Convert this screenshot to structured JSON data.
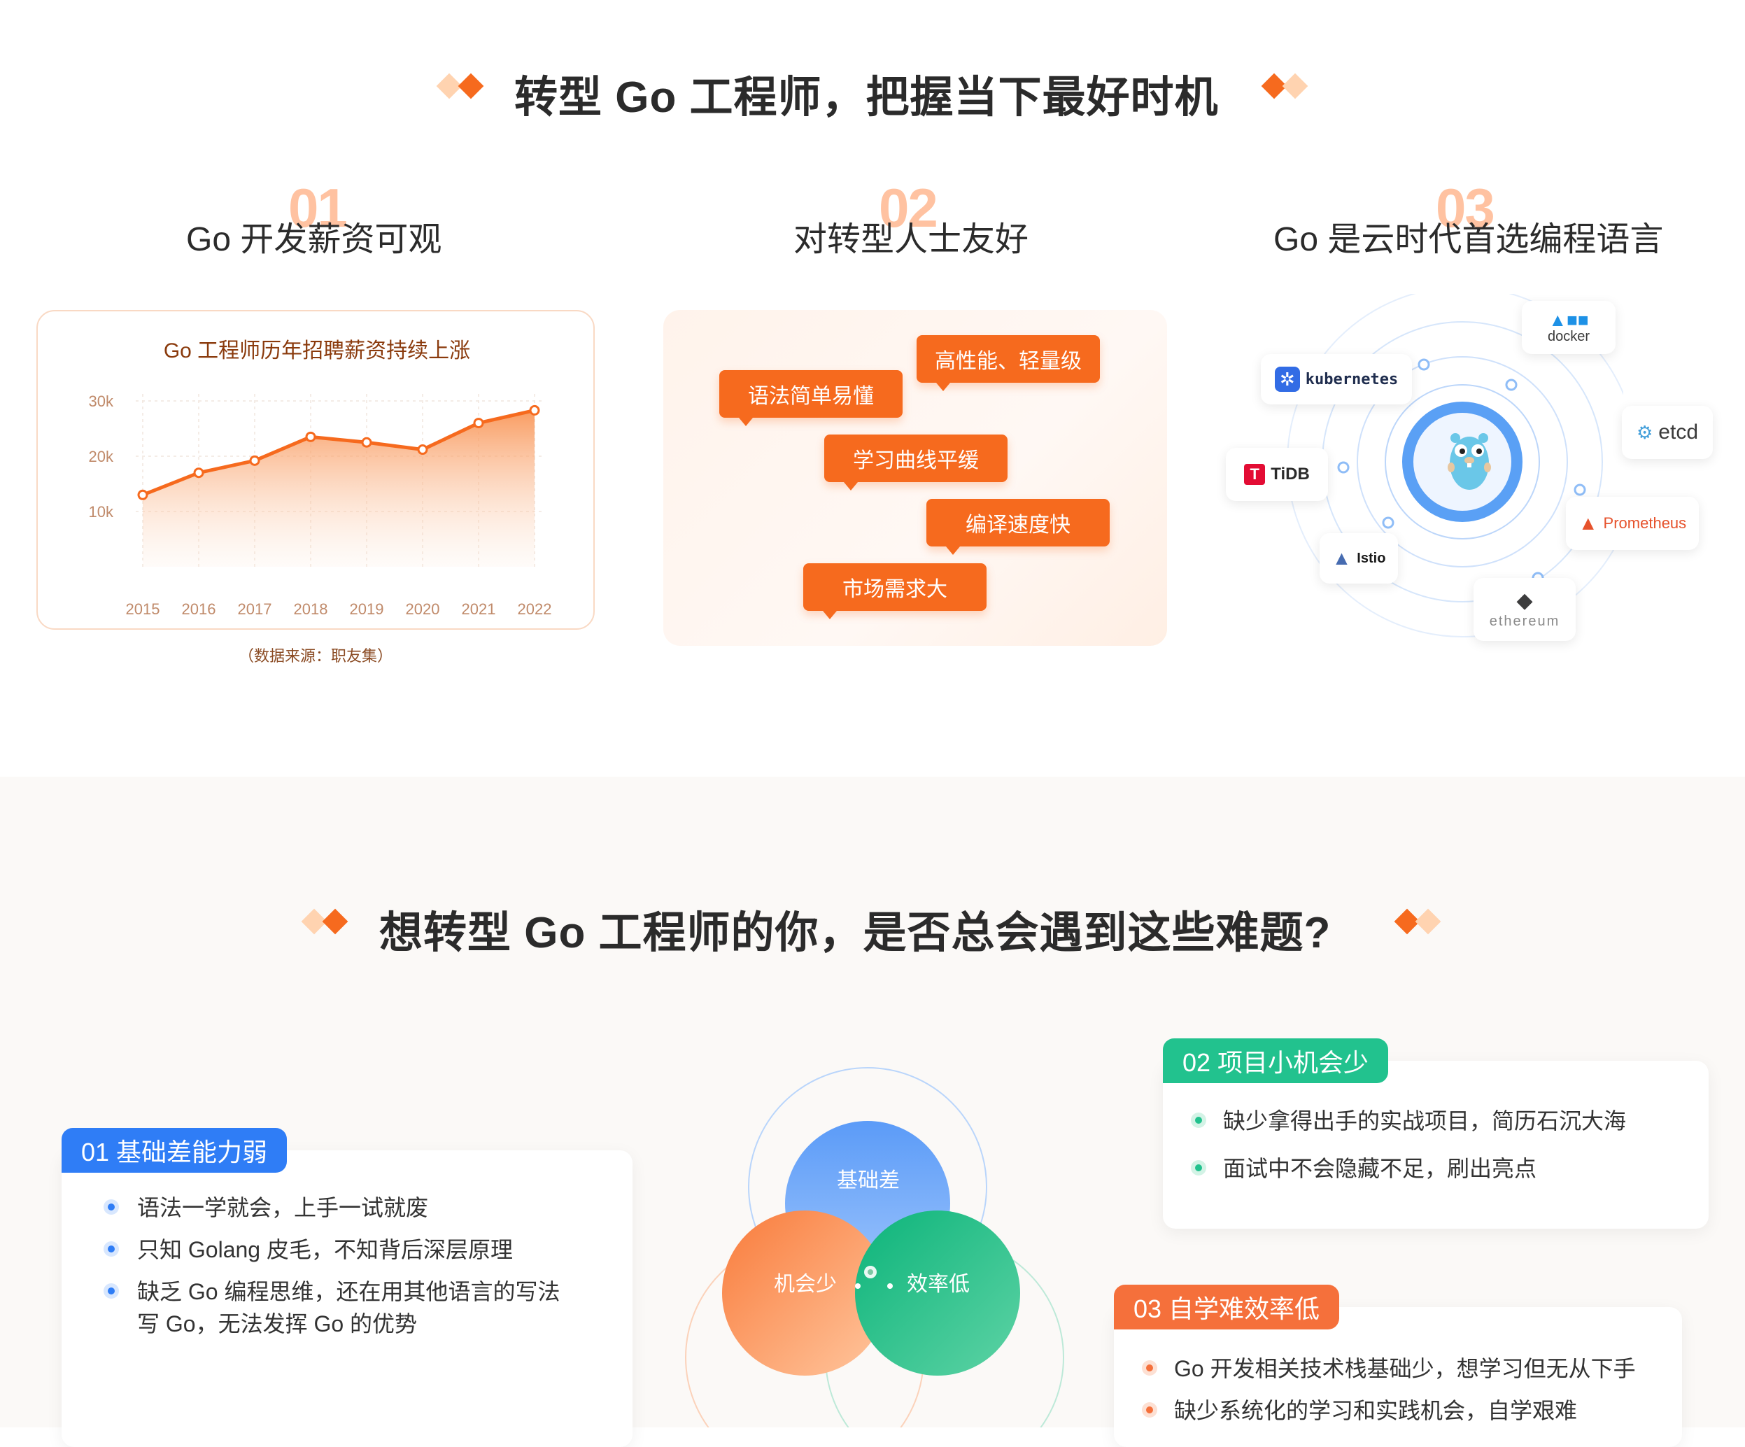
{
  "section1": {
    "title": "转型 Go 工程师，把握当下最好时机",
    "columns": [
      {
        "num": "01",
        "title": "Go 开发薪资可观"
      },
      {
        "num": "02",
        "title": "对转型人士友好"
      },
      {
        "num": "03",
        "title": "Go 是云时代首选编程语言"
      }
    ],
    "chart_source": "（数据来源：职友集）",
    "tags": [
      "高性能、轻量级",
      "语法简单易懂",
      "学习曲线平缓",
      "编译速度快",
      "市场需求大"
    ],
    "ecosystem": [
      "docker",
      "kubernetes",
      "etcd",
      "TiDB",
      "Prometheus",
      "Istio",
      "ethereum"
    ]
  },
  "chart_data": {
    "type": "area",
    "title": "Go 工程师历年招聘薪资持续上涨",
    "categories": [
      "2015",
      "2016",
      "2017",
      "2018",
      "2019",
      "2020",
      "2021",
      "2022"
    ],
    "values": [
      13000,
      17000,
      19200,
      23500,
      22500,
      21200,
      26000,
      28300
    ],
    "yticks": [
      "10k",
      "20k",
      "30k"
    ],
    "ylim": [
      0,
      30000
    ],
    "grid": true,
    "color": "#f66a1e"
  },
  "section2": {
    "title": "想转型 Go 工程师的你，是否总会遇到这些难题?",
    "venn": [
      "基础差",
      "机会少",
      "效率低"
    ],
    "problems": [
      {
        "tag": "01 基础差能力弱",
        "color": "#2f7df6",
        "items": [
          "语法一学就会，上手一试就废",
          "只知 Golang 皮毛，不知背后深层原理",
          "缺乏 Go 编程思维，还在用其他语言的写法",
          "写 Go，无法发挥 Go 的优势"
        ]
      },
      {
        "tag": "02 项目小机会少",
        "color": "#22c28e",
        "items": [
          "缺少拿得出手的实战项目，简历石沉大海",
          "面试中不会隐藏不足，刷出亮点"
        ]
      },
      {
        "tag": "03 自学难效率低",
        "color": "#f5703b",
        "items": [
          "Go 开发相关技术栈基础少，想学习但无从下手",
          "缺少系统化的学习和实践机会，自学艰难"
        ]
      }
    ]
  }
}
